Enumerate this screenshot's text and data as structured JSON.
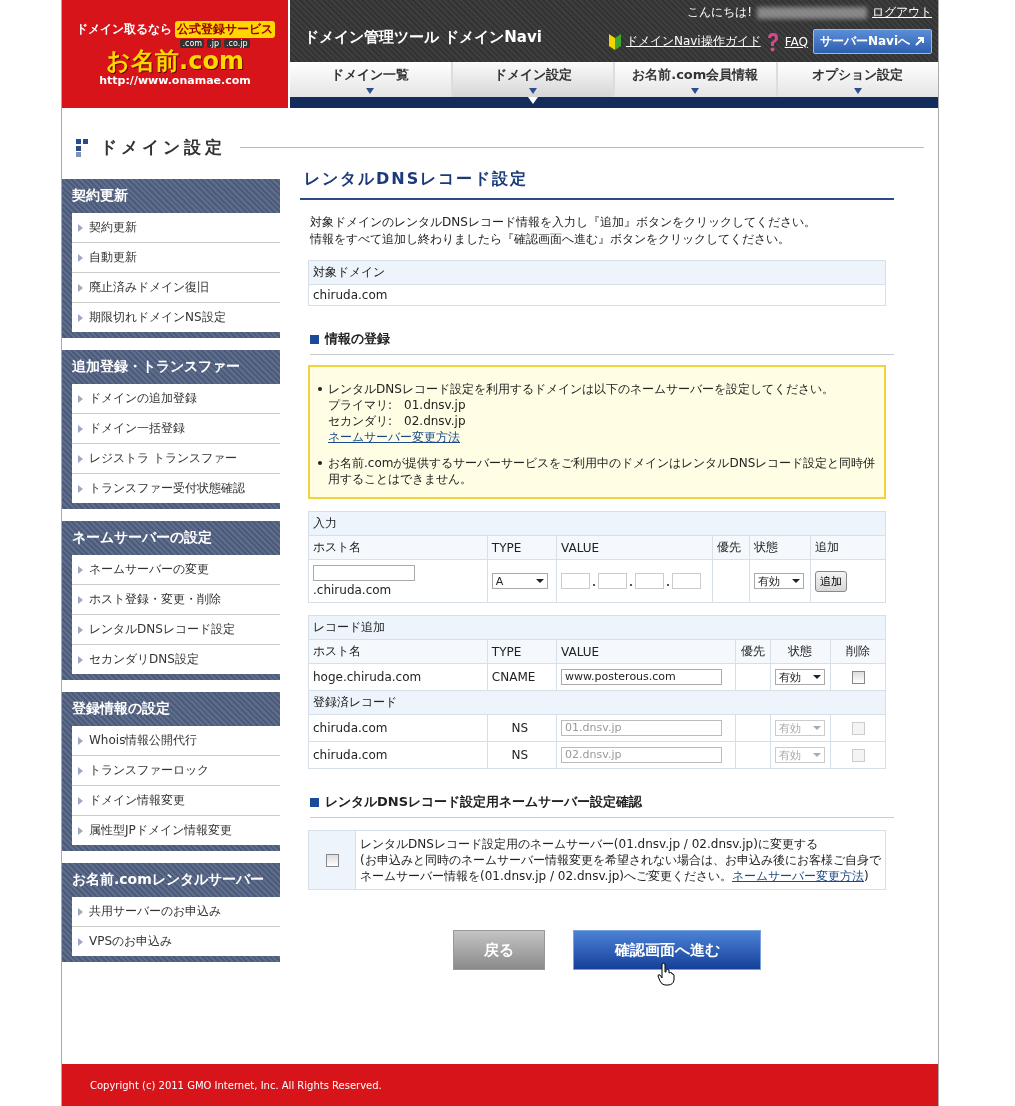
{
  "header": {
    "logo": {
      "tagline": "ドメイン取るなら",
      "badge": "公式登録サービス",
      "tlds": [
        ".com",
        ".jp",
        ".co.jp"
      ],
      "brand": "お名前.com",
      "url": "http://www.onamae.com"
    },
    "tool_title": "ドメイン管理ツール ドメインNavi",
    "greeting": "こんにちは!",
    "logout": "ログアウト",
    "guide_link": "ドメインNavi操作ガイド",
    "faq_link": "FAQ",
    "server_button": "サーバーNaviへ",
    "tabs": [
      {
        "label": "ドメイン一覧",
        "selected": false
      },
      {
        "label": "ドメイン設定",
        "selected": true
      },
      {
        "label": "お名前.com会員情報",
        "selected": false
      },
      {
        "label": "オプション設定",
        "selected": false
      }
    ]
  },
  "page_title": "ドメイン設定",
  "sidebar": {
    "groups": [
      {
        "title": "契約更新",
        "items": [
          "契約更新",
          "自動更新",
          "廃止済みドメイン復旧",
          "期限切れドメインNS設定"
        ]
      },
      {
        "title": "追加登録・トランスファー",
        "items": [
          "ドメインの追加登録",
          "ドメイン一括登録",
          "レジストラ トランスファー",
          "トランスファー受付状態確認"
        ]
      },
      {
        "title": "ネームサーバーの設定",
        "items": [
          "ネームサーバーの変更",
          "ホスト登録・変更・削除",
          "レンタルDNSレコード設定",
          "セカンダリDNS設定"
        ]
      },
      {
        "title": "登録情報の設定",
        "items": [
          "Whois情報公開代行",
          "トランスファーロック",
          "ドメイン情報変更",
          "属性型JPドメイン情報変更"
        ]
      },
      {
        "title": "お名前.comレンタルサーバー",
        "items": [
          "共用サーバーのお申込み",
          "VPSのお申込み"
        ]
      }
    ]
  },
  "main": {
    "heading": "レンタルDNSレコード設定",
    "intro": [
      "対象ドメインのレンタルDNSレコード情報を入力し『追加』ボタンをクリックしてください。",
      "情報をすべて追加し終わりましたら『確認画面へ進む』ボタンをクリックしてください。"
    ],
    "target_domain": {
      "label": "対象ドメイン",
      "value": "chiruda.com"
    },
    "section_title": "情報の登録",
    "notice": {
      "first": "レンタルDNSレコード設定を利用するドメインは以下のネームサーバーを設定してください。",
      "primary": "プライマリ:　01.dnsv.jp",
      "secondary": "セカンダリ:　02.dnsv.jp",
      "link": "ネームサーバー変更方法",
      "second": "お名前.comが提供するサーバーサービスをご利用中のドメインはレンタルDNSレコード設定と同時併用することはできません。"
    },
    "input_table": {
      "caption": "入力",
      "columns": [
        "ホスト名",
        "TYPE",
        "VALUE",
        "優先",
        "状態",
        "追加"
      ],
      "host_suffix": ".chiruda.com",
      "type": "A",
      "status": "有効",
      "add_button": "追加"
    },
    "records_table": {
      "caption": "レコード追加",
      "columns": [
        "ホスト名",
        "TYPE",
        "VALUE",
        "優先",
        "状態",
        "削除"
      ],
      "rows": [
        {
          "host": "hoge.chiruda.com",
          "type": "CNAME",
          "value": "www.posterous.com",
          "status": "有効",
          "disabled": false,
          "checked": false
        }
      ],
      "registered_caption": "登録済レコード",
      "registered_rows": [
        {
          "host": "chiruda.com",
          "type": "NS",
          "value": "01.dnsv.jp",
          "status": "有効",
          "disabled": true,
          "checked": false
        },
        {
          "host": "chiruda.com",
          "type": "NS",
          "value": "02.dnsv.jp",
          "status": "有効",
          "disabled": true,
          "checked": false
        }
      ]
    },
    "confirm": {
      "title": "レンタルDNSレコード設定用ネームサーバー設定確認",
      "checked": false,
      "line1": "レンタルDNSレコード設定用のネームサーバー(01.dnsv.jp / 02.dnsv.jp)に変更する",
      "line2": "(お申込みと同時のネームサーバー情報変更を希望されない場合は、お申込み後にお客様ご自身でネームサーバー情報を(01.dnsv.jp / 02.dnsv.jp)へご変更ください。",
      "link": "ネームサーバー変更方法",
      "tail": ")"
    },
    "back_button": "戻る",
    "next_button": "確認画面へ進む"
  },
  "footer": "Copyright (c) 2011 GMO Internet, Inc. All Rights Reserved."
}
